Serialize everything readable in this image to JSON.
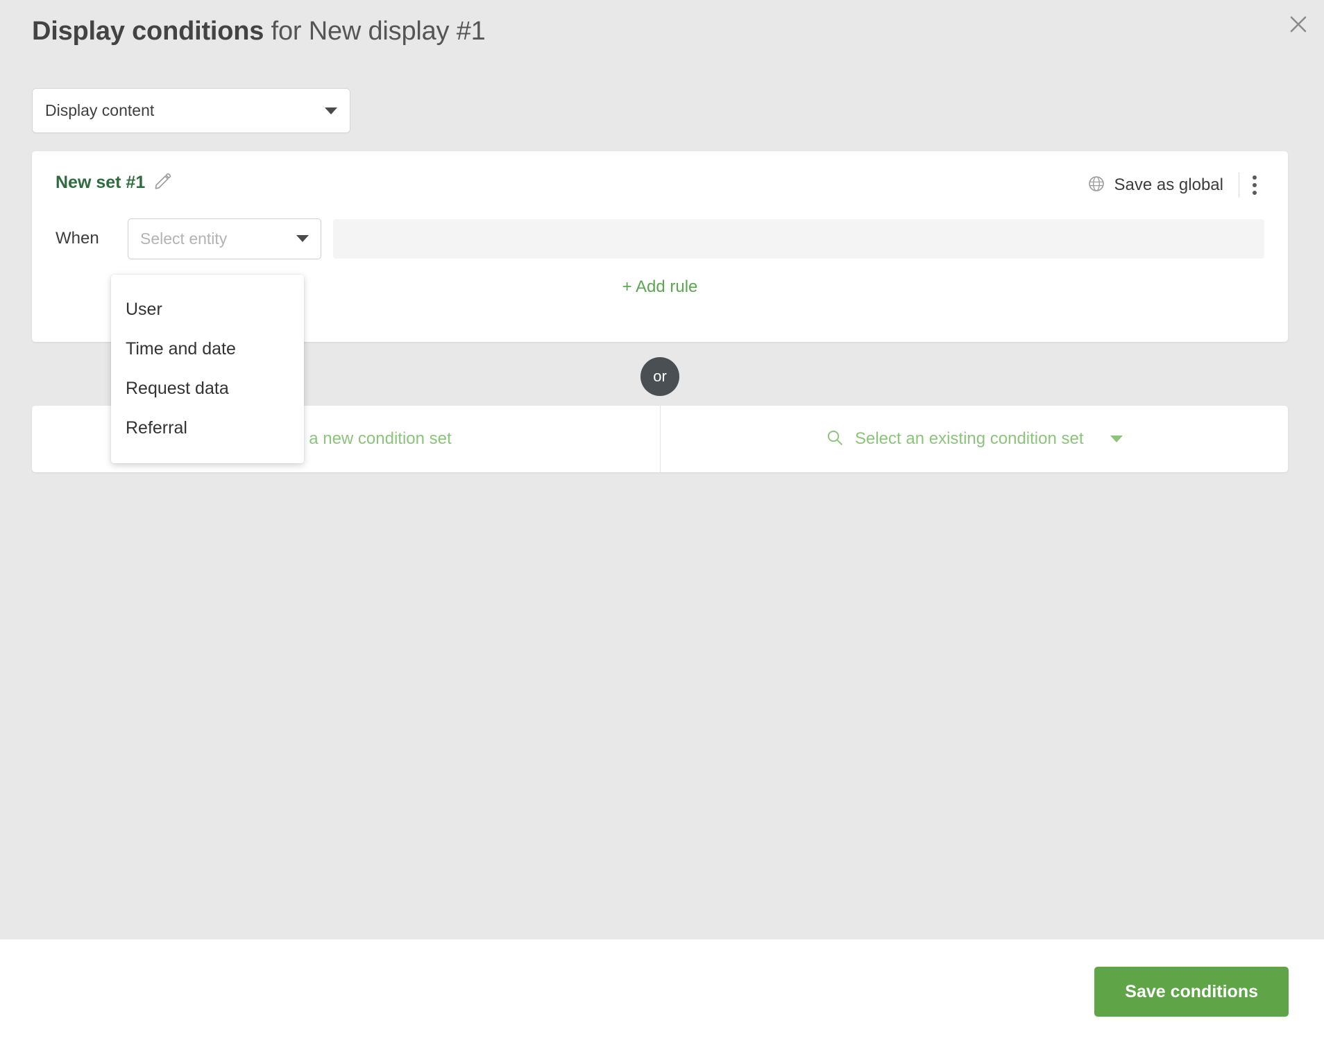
{
  "dialog": {
    "title_strong": "Display conditions",
    "title_rest": " for New display #1",
    "close_icon": "close-icon"
  },
  "display_select": {
    "value": "Display content",
    "caret_icon": "chevron-down-icon"
  },
  "rule_card": {
    "set_name": "New set #1",
    "edit_icon": "pencil-icon",
    "save_as_global_label": "Save as global",
    "globe_icon": "globe-icon",
    "more_icon": "kebab-menu-icon",
    "when_label": "When",
    "entity_placeholder": "Select entity",
    "entity_value": "",
    "value_field_value": "",
    "add_rule_label": "+ Add rule"
  },
  "entity_menu": {
    "items": [
      {
        "label": "User"
      },
      {
        "label": "Time and date"
      },
      {
        "label": "Request data"
      },
      {
        "label": "Referral"
      }
    ]
  },
  "separator": {
    "label": "or"
  },
  "condition_set_card": {
    "create_label": "+ Create a new condition set",
    "select_label": "Select an existing condition set",
    "search_icon": "search-icon",
    "caret_icon": "chevron-down-icon"
  },
  "footer": {
    "save_label": "Save conditions"
  },
  "colors": {
    "background": "#e8e8e8",
    "card": "#ffffff",
    "accent_green": "#5fa447",
    "light_green": "#8cc47c",
    "dark_green": "#2f6b3f",
    "or_badge": "#4a4f54",
    "muted_text": "#b3b3b3"
  }
}
